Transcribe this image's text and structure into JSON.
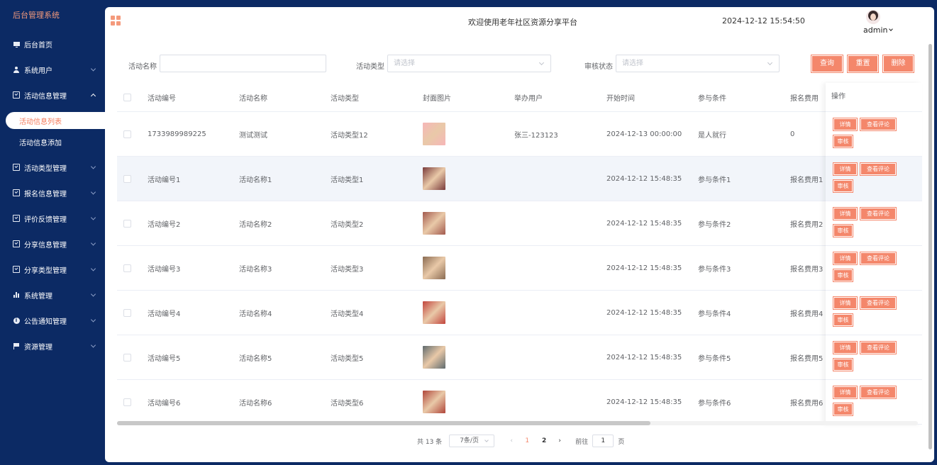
{
  "sidebar": {
    "brand": "后台管理系统",
    "menu": [
      {
        "label": "后台首页",
        "icon": "monitor-icon"
      },
      {
        "label": "系统用户",
        "icon": "user-icon"
      },
      {
        "label": "活动信息管理",
        "icon": "checkbox-icon",
        "expanded": true
      },
      {
        "label": "活动类型管理",
        "icon": "checkbox-icon"
      },
      {
        "label": "报名信息管理",
        "icon": "checkbox-icon"
      },
      {
        "label": "评价反馈管理",
        "icon": "checkbox-icon"
      },
      {
        "label": "分享信息管理",
        "icon": "checkbox-icon"
      },
      {
        "label": "分享类型管理",
        "icon": "checkbox-icon"
      },
      {
        "label": "系统管理",
        "icon": "bar-chart-icon"
      },
      {
        "label": "公告通知管理",
        "icon": "info-icon"
      },
      {
        "label": "资源管理",
        "icon": "flag-icon"
      }
    ],
    "submenu": [
      {
        "label": "活动信息列表",
        "active": true
      },
      {
        "label": "活动信息添加"
      }
    ]
  },
  "header": {
    "welcome": "欢迎使用老年社区资源分享平台",
    "datetime": "2024-12-12 15:54:50",
    "user": "admin"
  },
  "filters": {
    "name_label": "活动名称",
    "name_value": "",
    "type_label": "活动类型",
    "type_placeholder": "请选择",
    "status_label": "审核状态",
    "status_placeholder": "请选择",
    "query_button": "查询",
    "reset_button": "重置",
    "delete_button": "删除"
  },
  "table": {
    "columns": [
      "活动编号",
      "活动名称",
      "活动类型",
      "封面图片",
      "举办用户",
      "开始时间",
      "参与条件",
      "报名费用",
      "操作"
    ],
    "rows": [
      {
        "no": "1733989989225",
        "name": "测试测试",
        "type": "活动类型12",
        "user": "张三-123123",
        "start": "2024-12-13 00:00:00",
        "cond": "是人就行",
        "fee": "0",
        "img_color": "#f6b6b8"
      },
      {
        "no": "活动编号1",
        "name": "活动名称1",
        "type": "活动类型1",
        "user": "",
        "start": "2024-12-12 15:48:35",
        "cond": "参与条件1",
        "fee": "报名费用1",
        "img_color": "#7a3b3b"
      },
      {
        "no": "活动编号2",
        "name": "活动名称2",
        "type": "活动类型2",
        "user": "",
        "start": "2024-12-12 15:48:35",
        "cond": "参与条件2",
        "fee": "报名费用2",
        "img_color": "#a35a4e"
      },
      {
        "no": "活动编号3",
        "name": "活动名称3",
        "type": "活动类型3",
        "user": "",
        "start": "2024-12-12 15:48:35",
        "cond": "参与条件3",
        "fee": "报名费用3",
        "img_color": "#8a6b52"
      },
      {
        "no": "活动编号4",
        "name": "活动名称4",
        "type": "活动类型4",
        "user": "",
        "start": "2024-12-12 15:48:35",
        "cond": "参与条件4",
        "fee": "报名费用4",
        "img_color": "#c2453d"
      },
      {
        "no": "活动编号5",
        "name": "活动名称5",
        "type": "活动类型5",
        "user": "",
        "start": "2024-12-12 15:48:35",
        "cond": "参与条件5",
        "fee": "报名费用5",
        "img_color": "#5f6a6e"
      },
      {
        "no": "活动编号6",
        "name": "活动名称6",
        "type": "活动类型6",
        "user": "",
        "start": "2024-12-12 15:48:35",
        "cond": "参与条件6",
        "fee": "报名费用6",
        "img_color": "#b0463a"
      }
    ],
    "ops": {
      "detail": "详情",
      "comments": "查看评论",
      "audit": "审核"
    }
  },
  "pagination": {
    "total": "共 13 条",
    "page_size": "7条/页",
    "pages": [
      "1",
      "2"
    ],
    "current": "1",
    "goto_prefix": "前往",
    "goto_value": "1",
    "goto_suffix": "页"
  },
  "colors": {
    "accent": "#f4876b",
    "sidebar": "#0c2a64"
  }
}
